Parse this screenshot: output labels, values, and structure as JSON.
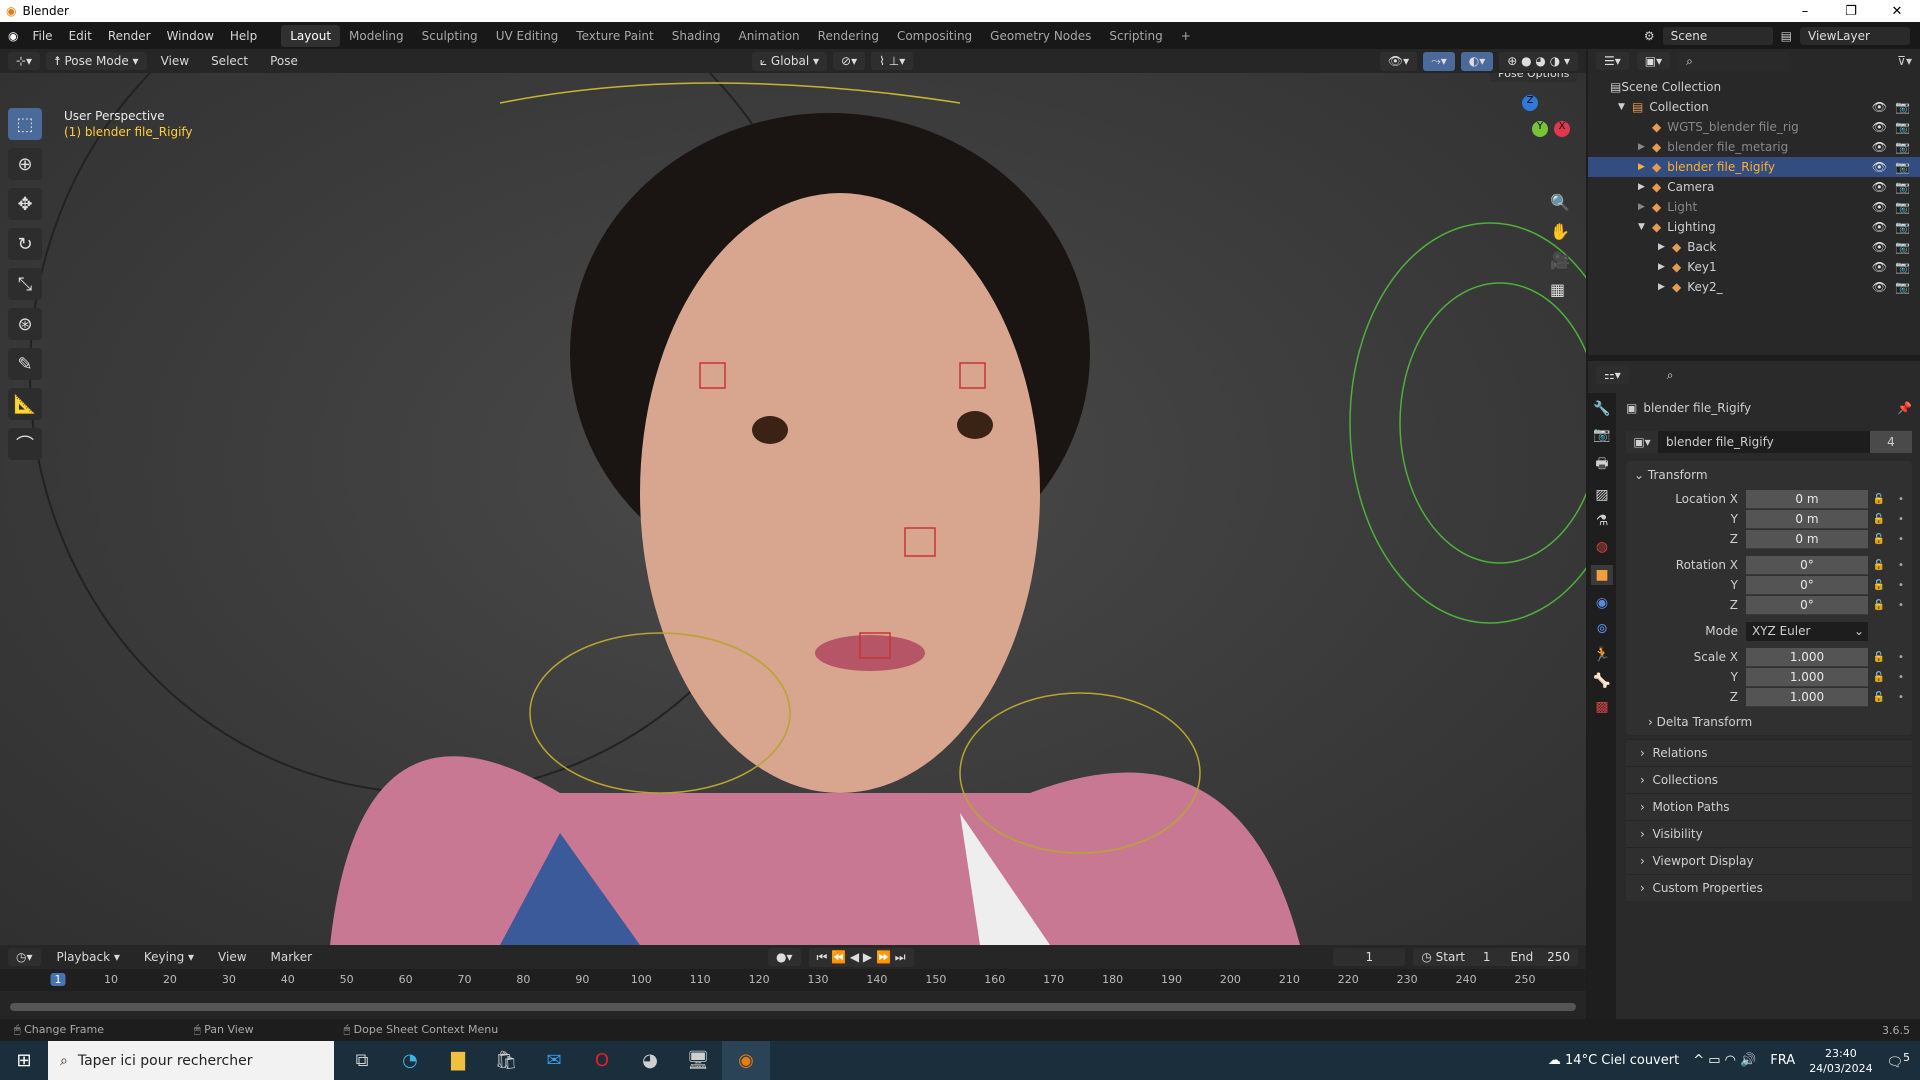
{
  "window": {
    "title": "Blender",
    "minimize": "–",
    "maximize": "❐",
    "close": "✕"
  },
  "menu": [
    "File",
    "Edit",
    "Render",
    "Window",
    "Help"
  ],
  "workspaces": [
    "Layout",
    "Modeling",
    "Sculpting",
    "UV Editing",
    "Texture Paint",
    "Shading",
    "Animation",
    "Rendering",
    "Compositing",
    "Geometry Nodes",
    "Scripting",
    "+"
  ],
  "scene": "Scene",
  "view_layer": "ViewLayer",
  "viewport_header": {
    "mode": "Pose Mode",
    "menus": [
      "View",
      "Select",
      "Pose"
    ],
    "orientation": "Global",
    "pose_options": "Pose Options",
    "x_label": "X"
  },
  "viewport": {
    "perspective": "User Perspective",
    "object": "(1) blender file_Rigify",
    "gizmo": {
      "x": "X",
      "y": "Y",
      "z": "Z"
    }
  },
  "outliner": {
    "root": "Scene Collection",
    "items": [
      {
        "name": "Collection",
        "indent": 1,
        "state": "normal"
      },
      {
        "name": "WGTS_blender file_rig",
        "indent": 2,
        "state": "dim"
      },
      {
        "name": "blender file_metarig",
        "indent": 2,
        "state": "dim"
      },
      {
        "name": "blender file_Rigify",
        "indent": 2,
        "state": "selected"
      },
      {
        "name": "Camera",
        "indent": 2,
        "state": "normal"
      },
      {
        "name": "Light",
        "indent": 2,
        "state": "dim"
      },
      {
        "name": "Lighting",
        "indent": 2,
        "state": "normal"
      },
      {
        "name": "Back",
        "indent": 3,
        "state": "normal"
      },
      {
        "name": "Key1",
        "indent": 3,
        "state": "normal"
      },
      {
        "name": "Key2_",
        "indent": 3,
        "state": "normal"
      }
    ]
  },
  "properties": {
    "object_name": "blender file_Rigify",
    "data_name": "blender file_Rigify",
    "users": "4",
    "transform_label": "Transform",
    "rows": [
      {
        "label": "Location X",
        "value": "0 m"
      },
      {
        "label": "Y",
        "value": "0 m"
      },
      {
        "label": "Z",
        "value": "0 m"
      },
      {
        "label": "Rotation X",
        "value": "0°"
      },
      {
        "label": "Y",
        "value": "0°"
      },
      {
        "label": "Z",
        "value": "0°"
      }
    ],
    "mode_label": "Mode",
    "mode_value": "XYZ Euler",
    "scale": [
      {
        "label": "Scale X",
        "value": "1.000"
      },
      {
        "label": "Y",
        "value": "1.000"
      },
      {
        "label": "Z",
        "value": "1.000"
      }
    ],
    "delta": "Delta Transform",
    "sections": [
      "Relations",
      "Collections",
      "Motion Paths",
      "Visibility",
      "Viewport Display",
      "Custom Properties"
    ]
  },
  "timeline": {
    "menus": [
      "Playback",
      "Keying",
      "View",
      "Marker"
    ],
    "current_frame": "1",
    "start_label": "Start",
    "start": "1",
    "end_label": "End",
    "end": "250",
    "ticks": [
      "1",
      "10",
      "20",
      "30",
      "40",
      "50",
      "60",
      "70",
      "80",
      "90",
      "100",
      "110",
      "120",
      "130",
      "140",
      "150",
      "160",
      "170",
      "180",
      "190",
      "200",
      "210",
      "220",
      "230",
      "240",
      "250"
    ]
  },
  "status": {
    "items": [
      "Change Frame",
      "Pan View",
      "Dope Sheet Context Menu"
    ],
    "version": "3.6.5"
  },
  "taskbar": {
    "search_placeholder": "Taper ici pour rechercher",
    "weather": "14°C  Ciel couvert",
    "lang": "FRA",
    "time": "23:40",
    "date": "24/03/2024",
    "notif": "5"
  }
}
